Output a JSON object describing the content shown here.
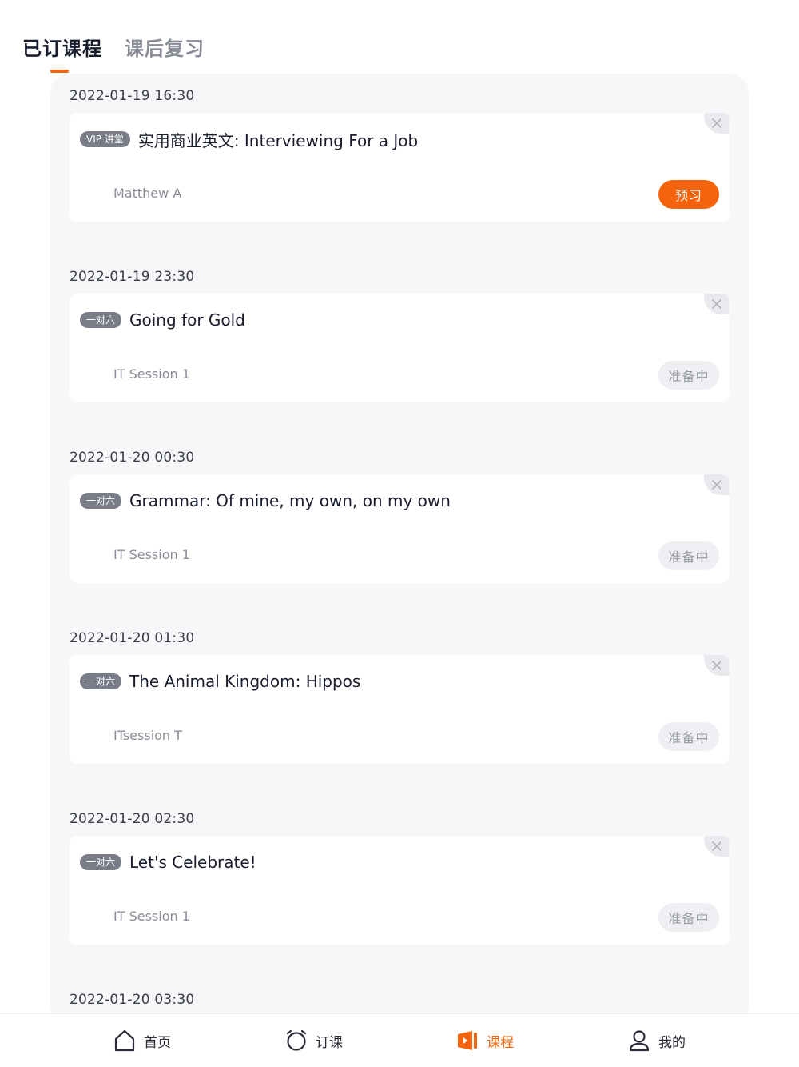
{
  "tabs": [
    {
      "label": "已订课程",
      "active": true
    },
    {
      "label": "课后复习",
      "active": false
    }
  ],
  "lessons": [
    {
      "time": "2022-01-19 16:30",
      "badge": "VIP 讲堂",
      "title": "实用商业英文: Interviewing For a Job",
      "teacher": "Matthew A",
      "action": "预习",
      "action_style": "primary"
    },
    {
      "time": "2022-01-19 23:30",
      "badge": "一对六",
      "title": "Going for Gold",
      "teacher": "IT Session 1",
      "action": "准备中",
      "action_style": "muted"
    },
    {
      "time": "2022-01-20 00:30",
      "badge": "一对六",
      "title": "Grammar: Of mine, my own, on my own",
      "teacher": "IT Session 1",
      "action": "准备中",
      "action_style": "muted"
    },
    {
      "time": "2022-01-20 01:30",
      "badge": "一对六",
      "title": "The Animal Kingdom: Hippos",
      "teacher": "ITsession T",
      "action": "准备中",
      "action_style": "muted"
    },
    {
      "time": "2022-01-20 02:30",
      "badge": "一对六",
      "title": "Let's Celebrate!",
      "teacher": "IT Session 1",
      "action": "准备中",
      "action_style": "muted"
    },
    {
      "time": "2022-01-20 03:30"
    }
  ],
  "bottom_nav": [
    {
      "label": "首页",
      "icon": "home-icon",
      "active": false
    },
    {
      "label": "订课",
      "icon": "alarm-clock-icon",
      "active": false
    },
    {
      "label": "课程",
      "icon": "course-video-icon",
      "active": true
    },
    {
      "label": "我的",
      "icon": "user-icon",
      "active": false
    }
  ],
  "colors": {
    "accent": "#f5640d",
    "panel_bg": "#f6f7f9",
    "badge_bg": "#7a7d88",
    "muted_button_bg": "#eeeff2"
  }
}
